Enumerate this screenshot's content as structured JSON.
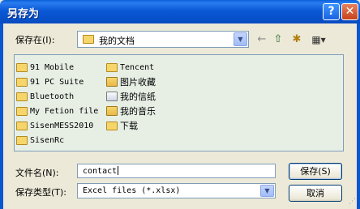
{
  "window": {
    "title": "另存为",
    "help_label": "?",
    "close_label": "✕"
  },
  "location": {
    "label": "保存在(I):",
    "value": "我的文档",
    "folder_icon": "documents-folder-icon"
  },
  "toolbar": {
    "back_icon": "←",
    "up_icon": "⇧",
    "new_folder_icon": "✱",
    "view_icon": "▦▾"
  },
  "files": {
    "column1": [
      {
        "name": "91 Mobile",
        "icon": "folder-icon"
      },
      {
        "name": "91 PC Suite",
        "icon": "folder-icon"
      },
      {
        "name": "Bluetooth",
        "icon": "folder-icon"
      },
      {
        "name": "My Fetion file",
        "icon": "folder-icon"
      },
      {
        "name": "SisenMESS2010",
        "icon": "folder-icon"
      },
      {
        "name": "SisenRc",
        "icon": "folder-icon"
      }
    ],
    "column2": [
      {
        "name": "Tencent",
        "icon": "folder-icon"
      },
      {
        "name": "图片收藏",
        "icon": "pictures-folder-icon"
      },
      {
        "name": "我的信纸",
        "icon": "letter-folder-icon"
      },
      {
        "name": "我的音乐",
        "icon": "music-folder-icon"
      },
      {
        "name": "下载",
        "icon": "folder-icon"
      }
    ]
  },
  "filename": {
    "label": "文件名(N):",
    "value": "contact"
  },
  "filetype": {
    "label": "保存类型(T):",
    "value": "Excel files (*.xlsx)"
  },
  "buttons": {
    "save": "保存(S)",
    "cancel": "取消"
  }
}
